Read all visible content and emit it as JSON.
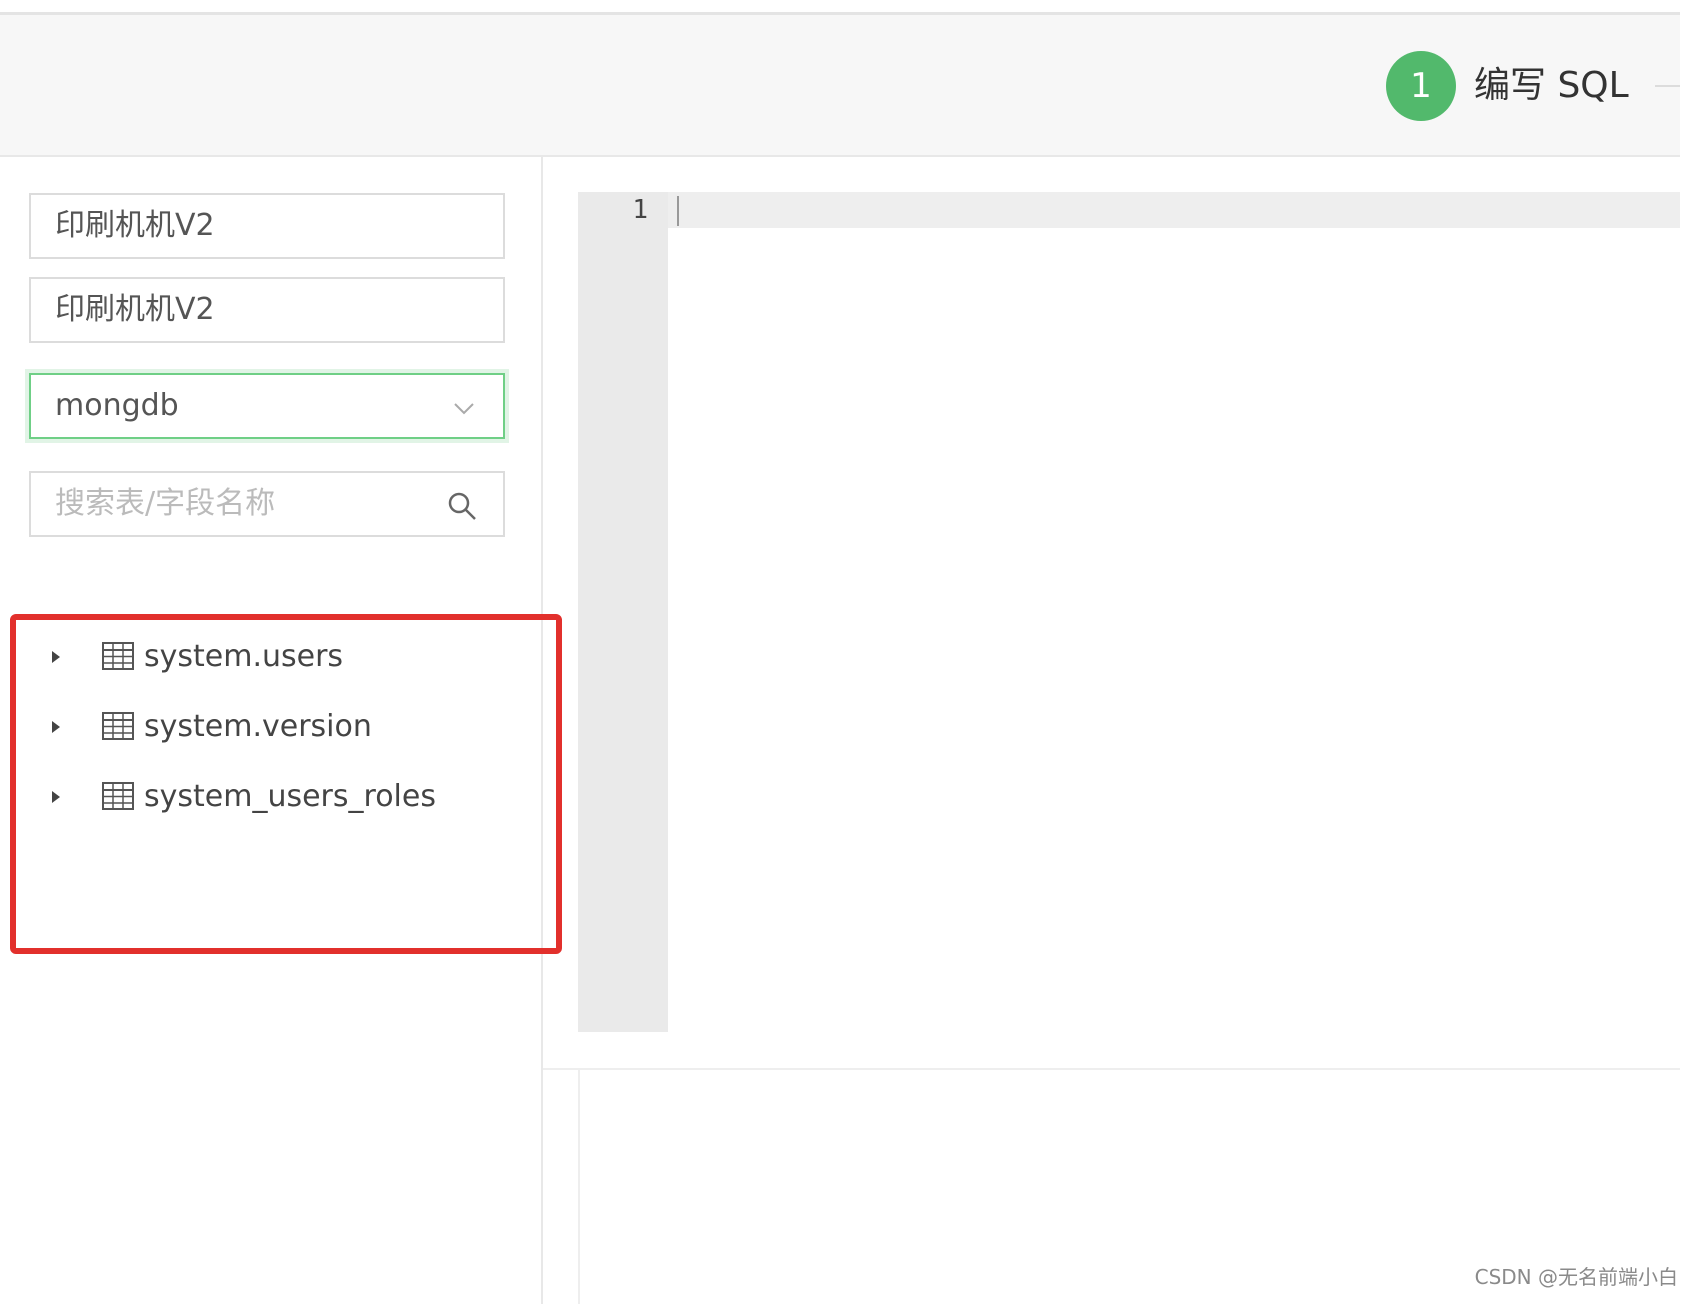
{
  "header": {
    "step": {
      "number": "1",
      "label": "编写 SQL"
    }
  },
  "sidebar": {
    "field1": {
      "value": "印刷机机V2"
    },
    "field2": {
      "value": "印刷机机V2"
    },
    "datasource": {
      "selected": "mongdb"
    },
    "search": {
      "placeholder": "搜索表/字段名称"
    },
    "tables": [
      {
        "label": "system.users",
        "icon": "table-icon",
        "expand_icon": "caret-right-icon"
      },
      {
        "label": "system.version",
        "icon": "table-icon",
        "expand_icon": "caret-right-icon"
      },
      {
        "label": "system_users_roles",
        "icon": "table-icon",
        "expand_icon": "caret-right-icon"
      }
    ]
  },
  "editor": {
    "line_numbers": [
      "1"
    ]
  },
  "colors": {
    "accent_green": "#52b96c",
    "highlight_red": "#e2302c"
  },
  "watermark": "CSDN @无名前端小白"
}
